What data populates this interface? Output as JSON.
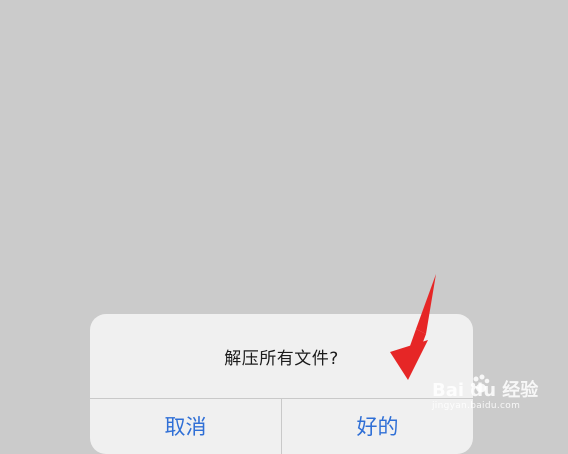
{
  "dialog": {
    "title": "解压所有文件?",
    "cancel_label": "取消",
    "ok_label": "好的"
  },
  "watermark": {
    "text": "Bai du 经验",
    "url": "jingyan.baidu.com"
  },
  "colors": {
    "background": "#cbcbcb",
    "dialog": "#f0f0f0",
    "button_text": "#2f6fd6",
    "arrow": "#e62626"
  },
  "icons": [
    "red-arrow-icon",
    "baidu-paw-icon"
  ]
}
